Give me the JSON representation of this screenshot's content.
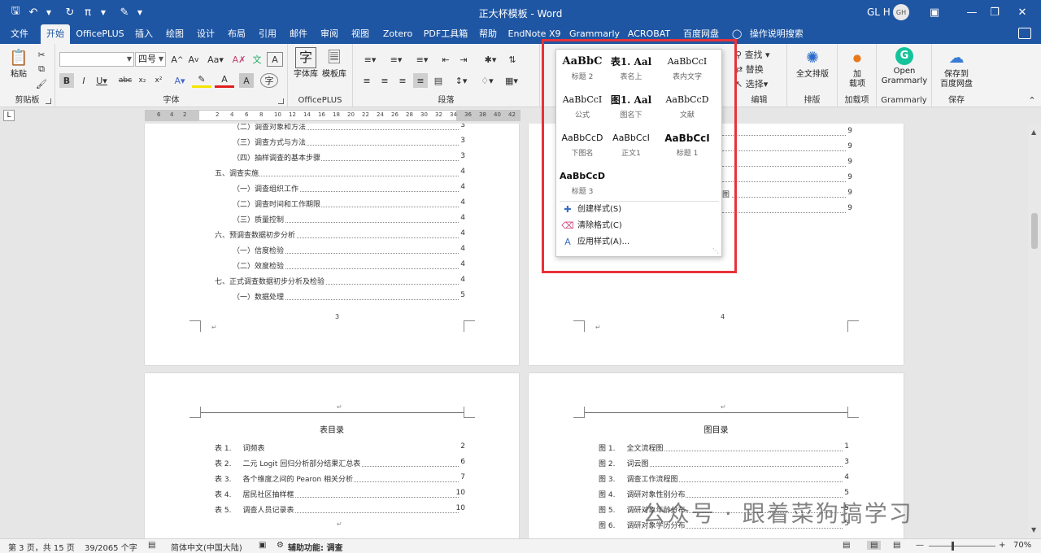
{
  "window": {
    "title": "正大杯模板 - Word",
    "user_name": "GL H",
    "user_initials": "GH"
  },
  "tabs": [
    {
      "label": "文件"
    },
    {
      "label": "开始"
    },
    {
      "label": "OfficePLUS"
    },
    {
      "label": "插入"
    },
    {
      "label": "绘图"
    },
    {
      "label": "设计"
    },
    {
      "label": "布局"
    },
    {
      "label": "引用"
    },
    {
      "label": "邮件"
    },
    {
      "label": "审阅"
    },
    {
      "label": "视图"
    },
    {
      "label": "Zotero"
    },
    {
      "label": "PDF工具箱"
    },
    {
      "label": "帮助"
    },
    {
      "label": "EndNote X9"
    },
    {
      "label": "Grammarly"
    },
    {
      "label": "ACROBAT"
    },
    {
      "label": "百度网盘"
    }
  ],
  "tell_me": "操作说明搜索",
  "ribbon": {
    "clipboard": {
      "paste": "粘贴",
      "label": "剪贴板"
    },
    "font": {
      "name": "",
      "size": "四号",
      "label": "字体"
    },
    "officeplus": {
      "fontlib": "字体库",
      "templatelib": "模板库",
      "label": "OfficePLUS"
    },
    "paragraph": {
      "label": "段落"
    },
    "editing": {
      "find": "查找",
      "replace": "替换",
      "select": "选择",
      "label": "编辑"
    },
    "layout": {
      "fulltext": "全文排版",
      "label": "排版"
    },
    "addins": {
      "add": "加\n载项",
      "label": "加载项"
    },
    "grammarly": {
      "open": "Open\nGrammarly",
      "label": "Grammarly"
    },
    "save": {
      "button": "保存到\n百度网盘",
      "label": "保存"
    }
  },
  "styles_panel": {
    "styles": [
      {
        "preview": "AaBbC",
        "name": "标题 2"
      },
      {
        "preview": "表1. Aal",
        "name": "表名上"
      },
      {
        "preview": "AaBbCcI",
        "name": "表内文字"
      },
      {
        "preview": "AaBbCcI",
        "name": "公式"
      },
      {
        "preview": "图1. Aal",
        "name": "图名下"
      },
      {
        "preview": "AaBbCcD",
        "name": "文献"
      },
      {
        "preview": "AaBbCcD",
        "name": "下图名"
      },
      {
        "preview": "AaBbCcI",
        "name": "正文1"
      },
      {
        "preview": "AaBbCcI",
        "name": "标题 1"
      },
      {
        "preview": "AaBbCcD",
        "name": "标题 3"
      }
    ],
    "menu": [
      {
        "label": "创建样式(S)"
      },
      {
        "label": "清除格式(C)"
      },
      {
        "label": "应用样式(A)..."
      }
    ]
  },
  "ruler": [
    "6",
    "4",
    "2",
    "2",
    "4",
    "6",
    "8",
    "10",
    "12",
    "14",
    "16",
    "18",
    "20",
    "22",
    "24",
    "26",
    "28",
    "30",
    "32",
    "34",
    "36",
    "38",
    "40",
    "42"
  ],
  "page1": {
    "lines": [
      {
        "text": "（二）调查对象和方法",
        "page": "3"
      },
      {
        "text": "（三）调查方式与方法",
        "page": "3"
      },
      {
        "text": "（四）抽样调查的基本步骤",
        "page": "3"
      },
      {
        "text": "五、调查实施",
        "page": "4"
      },
      {
        "text": "（一）调查组织工作",
        "page": "4"
      },
      {
        "text": "（二）调查时间和工作期限",
        "page": "4"
      },
      {
        "text": "（三）质量控制",
        "page": "4"
      },
      {
        "text": "六、预调查数据初步分析",
        "page": "4"
      },
      {
        "text": "（一）信度检验",
        "page": "4"
      },
      {
        "text": "（二）效度检验",
        "page": "4"
      },
      {
        "text": "七、正式调查数据初步分析及检验",
        "page": "4"
      },
      {
        "text": "（一）数据处理",
        "page": "5"
      }
    ],
    "page_number": "3"
  },
  "page2": {
    "right_pages": [
      "9",
      "9",
      "9",
      "9",
      "9",
      "9"
    ],
    "fragment": "图",
    "page_number": "4"
  },
  "page3": {
    "title": "表目录",
    "lines": [
      {
        "num": "表 1.",
        "text": "词频表",
        "page": "2"
      },
      {
        "num": "表 2.",
        "text": "二元 Logit 回归分析部分结果汇总表",
        "page": "6"
      },
      {
        "num": "表 3.",
        "text": "各个维度之间的 Pearon 相关分析",
        "page": "7"
      },
      {
        "num": "表 4.",
        "text": "居民社区抽样框",
        "page": "10"
      },
      {
        "num": "表 5.",
        "text": "调查人员记录表",
        "page": "10"
      }
    ]
  },
  "page4": {
    "title": "图目录",
    "lines": [
      {
        "num": "图 1.",
        "text": "全文流程图",
        "page": "1"
      },
      {
        "num": "图 2.",
        "text": "词云图",
        "page": "3"
      },
      {
        "num": "图 3.",
        "text": "调查工作流程图",
        "page": "4"
      },
      {
        "num": "图 4.",
        "text": "调研对象性别分布",
        "page": "5"
      },
      {
        "num": "图 5.",
        "text": "调研对象年龄分布",
        "page": "5"
      },
      {
        "num": "图 6.",
        "text": "调研对象学历分布",
        "page": "5"
      }
    ]
  },
  "status": {
    "page": "第 3 页，共 15 页",
    "words": "39/2065 个字",
    "language": "简体中文(中国大陆)",
    "accessibility": "辅助功能: 调查",
    "zoom": "70%"
  },
  "watermark": "公众号 · 跟着菜狗搞学习",
  "colors": {
    "accent": "#1f56a3",
    "highlight": "#e8323a"
  }
}
